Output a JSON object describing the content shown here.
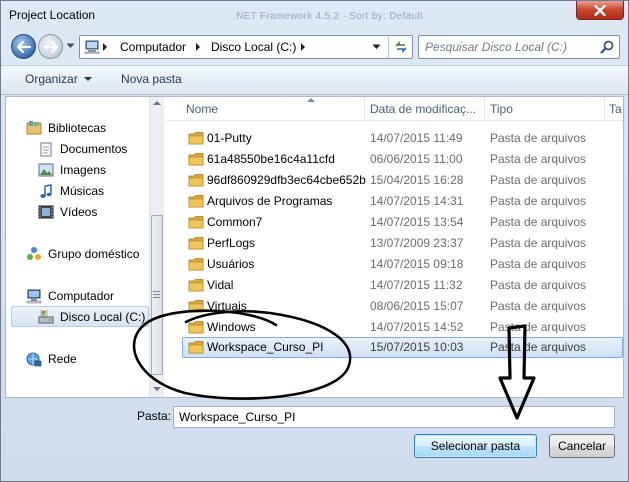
{
  "window": {
    "title": "Project Location",
    "ghost_title": ".NET Framework 4.5.2   ·   Sort by: Default"
  },
  "address": {
    "crumbs": [
      "Computador",
      "Disco Local (C:)"
    ]
  },
  "search": {
    "placeholder": "Pesquisar Disco Local (C:)"
  },
  "toolbar": {
    "organize_label": "Organizar",
    "new_folder_label": "Nova pasta"
  },
  "nav": {
    "libraries": "Bibliotecas",
    "documents": "Documentos",
    "images": "Imagens",
    "music": "Músicas",
    "videos": "Vídeos",
    "homegroup": "Grupo doméstico",
    "computer": "Computador",
    "local_disk": "Disco Local (C:)",
    "network": "Rede"
  },
  "columns": {
    "name": "Nome",
    "date": "Data de modificaç...",
    "type": "Tipo",
    "size": "Ta"
  },
  "files": [
    {
      "name": "01-Putty",
      "date": "14/07/2015 11:49",
      "type": "Pasta de arquivos"
    },
    {
      "name": "61a48550be16c4a11cfd",
      "date": "06/06/2015 11:00",
      "type": "Pasta de arquivos"
    },
    {
      "name": "96df860929dfb3ec64cbe652b",
      "date": "15/04/2015 16:28",
      "type": "Pasta de arquivos"
    },
    {
      "name": "Arquivos de Programas",
      "date": "14/07/2015 14:31",
      "type": "Pasta de arquivos"
    },
    {
      "name": "Common7",
      "date": "14/07/2015 13:54",
      "type": "Pasta de arquivos"
    },
    {
      "name": "PerfLogs",
      "date": "13/07/2009 23:37",
      "type": "Pasta de arquivos"
    },
    {
      "name": "Usuários",
      "date": "14/07/2015 09:18",
      "type": "Pasta de arquivos"
    },
    {
      "name": "Vidal",
      "date": "14/07/2015 11:32",
      "type": "Pasta de arquivos"
    },
    {
      "name": "Virtuais",
      "date": "08/06/2015 15:07",
      "type": "Pasta de arquivos"
    },
    {
      "name": "Windows",
      "date": "14/07/2015 14:52",
      "type": "Pasta de arquivos"
    },
    {
      "name": "Workspace_Curso_PI",
      "date": "15/07/2015 10:03",
      "type": "Pasta de arquivos",
      "selected": true
    }
  ],
  "folder_field": {
    "label": "Pasta:",
    "value": "Workspace_Curso_PI"
  },
  "buttons": {
    "select_folder": "Selecionar pasta",
    "cancel": "Cancelar"
  },
  "colors": {
    "folder": "#e7b94a",
    "selection": "#cfe0f5",
    "annotation": "#000000"
  }
}
